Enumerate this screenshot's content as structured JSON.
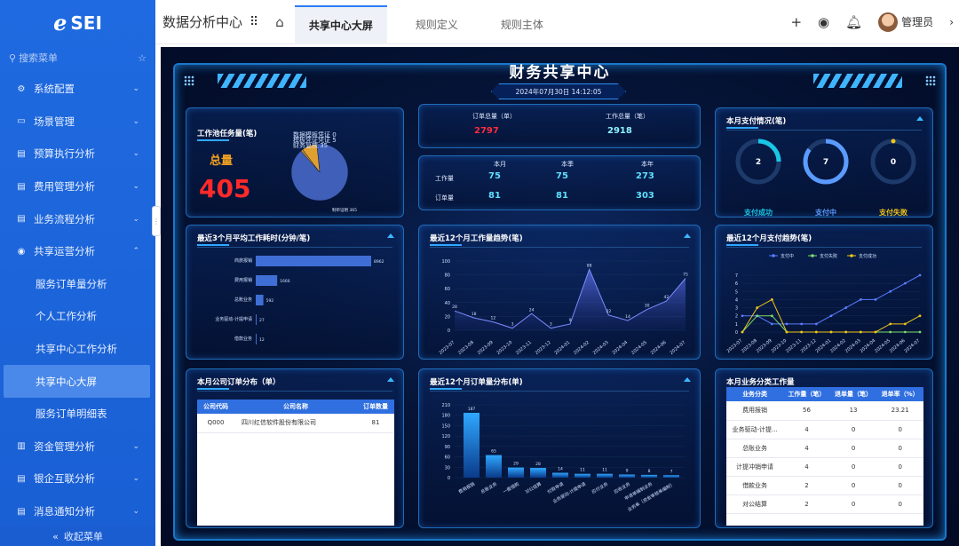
{
  "brand": {
    "logo_text": "SEI"
  },
  "sidebar": {
    "search_placeholder": "搜索菜单",
    "items": [
      {
        "label": "系统配置",
        "icon": "gear-icon",
        "expanded": false
      },
      {
        "label": "场景管理",
        "icon": "monitor-icon",
        "expanded": false
      },
      {
        "label": "预算执行分析",
        "icon": "doc-icon",
        "expanded": false
      },
      {
        "label": "费用管理分析",
        "icon": "doc-icon",
        "expanded": false
      },
      {
        "label": "业务流程分析",
        "icon": "doc-icon",
        "expanded": false
      },
      {
        "label": "共享运营分析",
        "icon": "eye-icon",
        "expanded": true
      }
    ],
    "sub_items": [
      "服务订单量分析",
      "个人工作分析",
      "共享中心工作分析",
      "共享中心大屏",
      "服务订单明细表"
    ],
    "active_sub": "共享中心大屏",
    "items_after": [
      {
        "label": "资金管理分析",
        "icon": "chart-icon"
      },
      {
        "label": "银企互联分析",
        "icon": "doc-icon"
      },
      {
        "label": "消息通知分析",
        "icon": "doc-icon"
      }
    ],
    "collapse_label": "收起菜单"
  },
  "topbar": {
    "app_title": "数据分析中心",
    "tabs": [
      {
        "label": "共享中心大屏",
        "active": true
      },
      {
        "label": "规则定义",
        "active": false
      },
      {
        "label": "规则主体",
        "active": false
      }
    ],
    "user_name": "管理员"
  },
  "dashboard": {
    "title": "财务共享中心",
    "date": "2024年07月30日 14:12:05",
    "pool": {
      "title": "工作池任务量(笔)",
      "total_label": "总量",
      "total_value": "405",
      "legend": [
        "数据模板凭证 0",
        "模板凭证凭证 5",
        "财务复核 35"
      ],
      "big_slice_label": "制单证明 365"
    },
    "summary": {
      "order_total_label": "订单总量（单）",
      "order_total": "2797",
      "work_total_label": "工作总量（笔）",
      "work_total": "2918",
      "cols": [
        "本月",
        "本季",
        "本年"
      ],
      "rows": [
        {
          "label": "工作量",
          "values": [
            "75",
            "75",
            "273"
          ]
        },
        {
          "label": "订单量",
          "values": [
            "81",
            "81",
            "303"
          ]
        }
      ]
    },
    "payment": {
      "title": "本月支付情况(笔)",
      "rings": [
        {
          "label": "支付成功",
          "value": "2",
          "color": "#19c6e6",
          "fill": 0.25
        },
        {
          "label": "支付中",
          "value": "7",
          "color": "#5b9bff",
          "fill": 0.85
        },
        {
          "label": "支付失败",
          "value": "0",
          "color": "#f0c419",
          "fill": 0
        }
      ]
    },
    "avg_time": {
      "title": "最近3个月平均工作耗时(分钟/笔)",
      "chart_data": {
        "type": "bar",
        "categories": [
          "商旅报销",
          "费用报销",
          "总账业务",
          "业务驱动-计提申请",
          "借款业务"
        ],
        "values": [
          8962,
          1666,
          592,
          27,
          12
        ],
        "value_labels": [
          "8962",
          "1666",
          "592",
          "27",
          "12"
        ]
      }
    },
    "work_trend": {
      "title": "最近12个月工作量趋势(笔)",
      "chart_data": {
        "type": "area",
        "x": [
          "2023-07",
          "2023-08",
          "2023-09",
          "2023-10",
          "2023-11",
          "2023-12",
          "2024-01",
          "2024-02",
          "2024-03",
          "2024-04",
          "2024-05",
          "2024-06",
          "2024-07"
        ],
        "values": [
          28,
          18,
          12,
          3,
          24,
          3,
          9,
          88,
          22,
          14,
          30,
          42,
          75
        ],
        "ylim": [
          0,
          100
        ],
        "yticks": [
          "0",
          "20",
          "40",
          "60",
          "80",
          "100"
        ]
      }
    },
    "pay_trend": {
      "title": "最近12个月支付趋势(笔)",
      "legend": [
        "支付中",
        "支付失败",
        "支付成功"
      ],
      "chart_data": {
        "type": "line",
        "x": [
          "2023-07",
          "2023-08",
          "2023-09",
          "2023-10",
          "2023-11",
          "2023-12",
          "2024-01",
          "2024-02",
          "2024-03",
          "2024-04",
          "2024-05",
          "2024-06",
          "2024-07"
        ],
        "series": [
          {
            "name": "支付中",
            "color": "#5b7cff",
            "values": [
              2,
              2,
              1,
              1,
              1,
              1,
              2,
              3,
              4,
              4,
              5,
              6,
              7
            ]
          },
          {
            "name": "支付失败",
            "color": "#7ddc6a",
            "values": [
              0,
              2,
              2,
              0,
              0,
              0,
              0,
              0,
              0,
              0,
              0,
              0,
              0
            ]
          },
          {
            "name": "支付成功",
            "color": "#f0c419",
            "values": [
              0,
              3,
              4,
              0,
              0,
              0,
              0,
              0,
              0,
              0,
              1,
              1,
              2
            ]
          }
        ],
        "ylim": [
          0,
          7
        ],
        "yticks": [
          "0",
          "1",
          "2",
          "3",
          "4",
          "5",
          "6",
          "7"
        ]
      }
    },
    "company_orders": {
      "title": "本月公司订单分布（单）",
      "headers": [
        "公司代码",
        "公司名称",
        "订单数量"
      ],
      "rows": [
        [
          "Q000",
          "四川红信软件股份有限公司",
          "81"
        ]
      ]
    },
    "order_dist": {
      "title": "最近12个月订单量分布(单)",
      "chart_data": {
        "type": "bar",
        "categories": [
          "费用报销",
          "总账业务",
          "一般借款",
          "对公结算",
          "付款申请",
          "业务驱动-计提申请",
          "应付业务",
          "应收业务",
          "申请单编制业务",
          "业务单（资金审核单编制）"
        ],
        "values": [
          187,
          65,
          29,
          28,
          14,
          11,
          11,
          9,
          8,
          7
        ],
        "ylim": [
          0,
          210
        ],
        "yticks": [
          "0",
          "30",
          "60",
          "90",
          "120",
          "150",
          "180",
          "210"
        ]
      }
    },
    "workload_type": {
      "title": "本月业务分类工作量",
      "headers": [
        "业务分类",
        "工作量（笔）",
        "退单量（笔）",
        "退单率（%）"
      ],
      "rows": [
        [
          "费用报销",
          "56",
          "13",
          "23.21"
        ],
        [
          "业务驱动-计提...",
          "4",
          "0",
          "0"
        ],
        [
          "总账业务",
          "4",
          "0",
          "0"
        ],
        [
          "计提冲销申请",
          "4",
          "0",
          "0"
        ],
        [
          "借款业务",
          "2",
          "0",
          "0"
        ],
        [
          "对公结算",
          "2",
          "0",
          "0"
        ]
      ]
    }
  }
}
